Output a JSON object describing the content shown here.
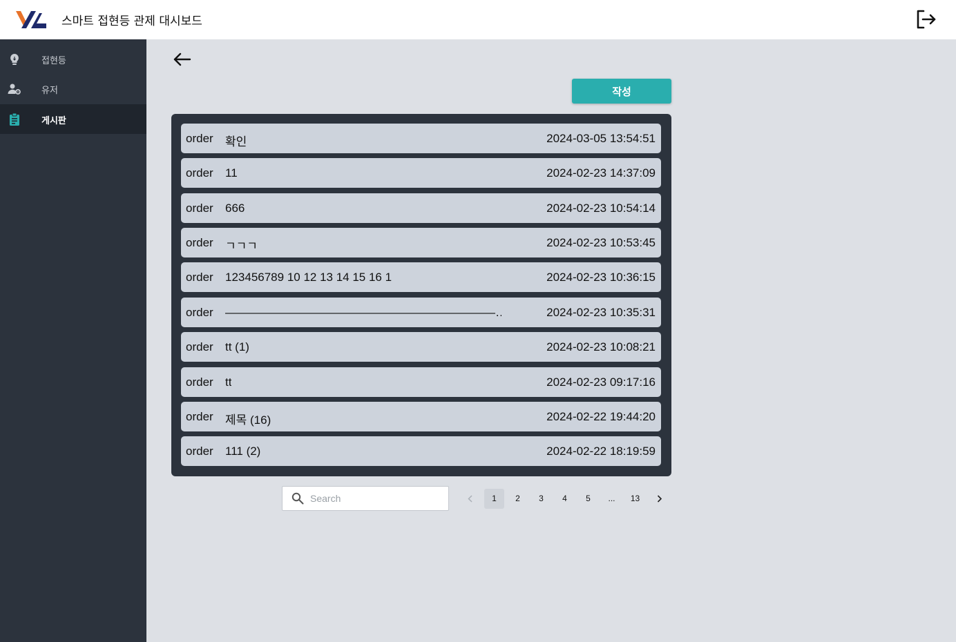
{
  "header": {
    "title": "스마트 접현등 관제 대시보드",
    "logo_icon": "vl-logo-icon",
    "logout_icon": "logout-icon"
  },
  "sidebar": {
    "items": [
      {
        "label": "접현등",
        "icon": "lightbulb-icon",
        "active": false
      },
      {
        "label": "유저",
        "icon": "user-gear-icon",
        "active": false
      },
      {
        "label": "게시판",
        "icon": "clipboard-icon",
        "active": true
      }
    ]
  },
  "toolbar": {
    "back_icon": "arrow-left-icon",
    "write_label": "작성",
    "accent_color": "#2aaeae"
  },
  "posts": [
    {
      "category": "order",
      "title": "확인",
      "date": "2024-03-05 13:54:51"
    },
    {
      "category": "order",
      "title": "11",
      "date": "2024-02-23 14:37:09"
    },
    {
      "category": "order",
      "title": "666",
      "date": "2024-02-23 10:54:14"
    },
    {
      "category": "order",
      "title": "ㄱㄱㄱ",
      "date": "2024-02-23 10:53:45"
    },
    {
      "category": "order",
      "title": "123456789 10 12 13 14 15 16 1",
      "date": "2024-02-23 10:36:15"
    },
    {
      "category": "order",
      "title": "———————————————————————…",
      "date": "2024-02-23 10:35:31"
    },
    {
      "category": "order",
      "title": "tt (1)",
      "date": "2024-02-23 10:08:21"
    },
    {
      "category": "order",
      "title": "tt",
      "date": "2024-02-23 09:17:16"
    },
    {
      "category": "order",
      "title": "제목 (16)",
      "date": "2024-02-22 19:44:20"
    },
    {
      "category": "order",
      "title": "111 (2)",
      "date": "2024-02-22 18:19:59"
    }
  ],
  "search": {
    "placeholder": "Search",
    "value": "",
    "icon": "search-icon"
  },
  "pagination": {
    "prev_icon": "chevron-left-icon",
    "next_icon": "chevron-right-icon",
    "pages": [
      "1",
      "2",
      "3",
      "4",
      "5",
      "...",
      "13"
    ],
    "current": "1"
  }
}
